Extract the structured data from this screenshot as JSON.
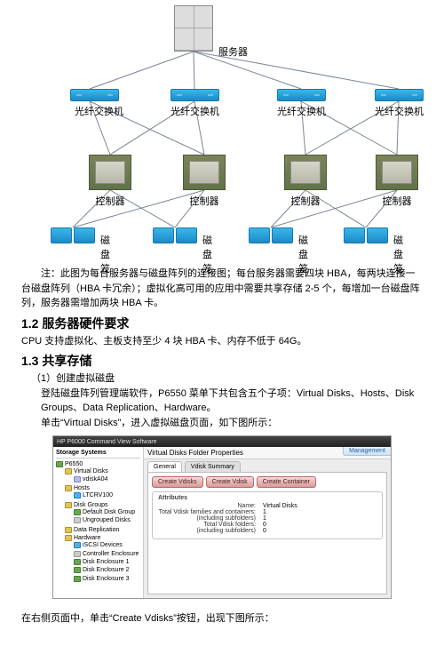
{
  "topology": {
    "server_label": "服务器",
    "switch_label": "光纤交换机",
    "controller_label": "控制器",
    "enclosure_label": "磁盘笼"
  },
  "note": "注：此图为每台服务器与磁盘阵列的连接图；每台服务器需要四块 HBA，每两块连接一台磁盘阵列（HBA 卡冗余）；虚拟化高可用的应用中需要共享存储 2-5 个，每增加一台磁盘阵列，服务器需增加两块 HBA 卡。",
  "sections": {
    "s12": "1.2 服务器硬件要求",
    "s12_body": "CPU 支持虚拟化、主板支持至少 4 块 HBA 卡、内存不低于 64G。",
    "s13": "1.3 共享存储",
    "s13_step1": "（1）创建虚拟磁盘",
    "s13_line1": "登陆磁盘阵列管理端软件，P6550 菜单下共包含五个子项：Virtual Disks、Hosts、Disk Groups、Data Replication、Hardware。",
    "s13_line2": "单击“Virtual Disks”，进入虚拟磁盘页面，如下图所示：",
    "s13_line3": "在右侧页面中，单击“Create Vdisks”按钮，出现下图所示："
  },
  "screenshot": {
    "titlebar": "HP P6000 Command View Software",
    "side_header": "Storage Systems",
    "tree": {
      "root": "P6550",
      "items": [
        "Virtual Disks",
        "Hosts",
        "Disk Groups",
        "Data Replication",
        "Hardware"
      ],
      "vdisks_child": "vdiskA04",
      "hosts_child": "LTCRV100",
      "dg_children": [
        "Default Disk Group",
        "Ungrouped Disks"
      ],
      "hw_children": [
        "iSCSI Devices",
        "Controller Enclosure",
        "Disk Enclosure 1",
        "Disk Enclosure 2",
        "Disk Enclosure 3"
      ]
    },
    "main_title": "Virtual Disks Folder Properties",
    "tabs": {
      "general": "General",
      "summary": "Vdisk Summary"
    },
    "buttons": {
      "b1": "Create Vdisks",
      "b2": "Create Vdisk",
      "b3": "Create Container"
    },
    "attr": {
      "title": "Attributes",
      "k1": "Name:",
      "v1": "Virtual Disks",
      "k2": "Total Vdisk families and containers:",
      "v2": "1",
      "k2s": "(including subfolders)",
      "v2s": "1",
      "k3": "Total Vdisk folders:",
      "v3": "0",
      "k3s": "(including subfolders)",
      "v3s": "0"
    },
    "management": "Management"
  }
}
